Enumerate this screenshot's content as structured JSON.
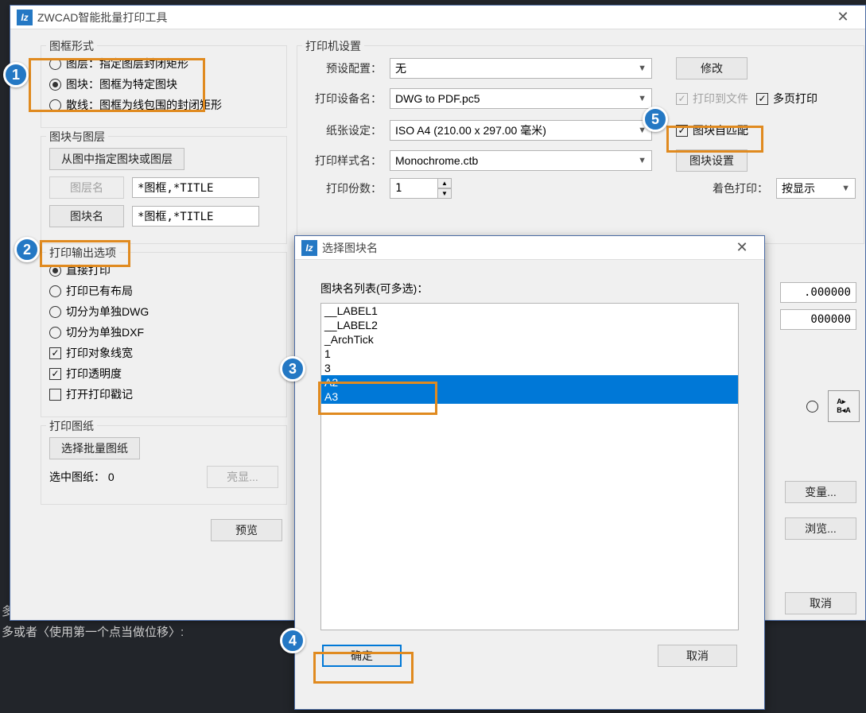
{
  "darkBgText1": "多",
  "darkBgText2": "多或者〈使用第一个点当做位移〉:",
  "mainWindow": {
    "title": "ZWCAD智能批量打印工具"
  },
  "frameStyle": {
    "legend": "图框形式",
    "optLayer": "图层：指定图层封闭矩形",
    "optBlock": "图块：图框为特定图块",
    "optScatter": "散线：图框为线包围的封闭矩形"
  },
  "blockLayer": {
    "legend": "图块与图层",
    "specifyBtn": "从图中指定图块或图层",
    "layerNameBtn": "图层名",
    "layerNameVal": "*图框,*TITLE",
    "blockNameBtn": "图块名",
    "blockNameVal": "*图框,*TITLE"
  },
  "outputOpts": {
    "legend": "打印输出选项",
    "directPrint": "直接打印",
    "printLayout": "打印已有布局",
    "splitDWG": "切分为单独DWG",
    "splitDXF": "切分为单独DXF",
    "lineWeight": "打印对象线宽",
    "transparency": "打印透明度",
    "stamp": "打开打印戳记"
  },
  "printSheet": {
    "legend": "打印图纸",
    "selectBtn": "选择批量图纸",
    "selectedLabel": "选中图纸：",
    "selectedCount": "0",
    "highlightBtn": "亮显..."
  },
  "printerSettings": {
    "legend": "打印机设置",
    "presetLabel": "预设配置：",
    "presetVal": "无",
    "modifyBtn": "修改",
    "deviceLabel": "打印设备名：",
    "deviceVal": "DWG to PDF.pc5",
    "printToFile": "打印到文件",
    "multiPage": "多页打印",
    "paperLabel": "纸张设定：",
    "paperVal": "ISO A4 (210.00 x 297.00 毫米)",
    "blockAutoMatch": "图块自匹配",
    "styleLabel": "打印样式名：",
    "styleVal": "Monochrome.ctb",
    "blockSettingsBtn": "图块设置",
    "copiesLabel": "打印份数：",
    "copiesVal": "1",
    "shadeLabel": "着色打印：",
    "shadeVal": "按显示"
  },
  "rightEdgeVals": {
    "val1": ".000000",
    "val2": "000000"
  },
  "rightButtons": {
    "variable": "变量...",
    "browse": "浏览...",
    "cancel": "取消"
  },
  "previewBtn": "预览",
  "modal": {
    "title": "选择图块名",
    "listLabel": "图块名列表(可多选)：",
    "items": [
      "__LABEL1",
      "__LABEL2",
      "_ArchTick",
      "1",
      "3",
      "A2",
      "A3"
    ],
    "okBtn": "确定",
    "cancelBtn": "取消"
  },
  "annotations": {
    "a1": "1",
    "a2": "2",
    "a3": "3",
    "a4": "4",
    "a5": "5"
  }
}
